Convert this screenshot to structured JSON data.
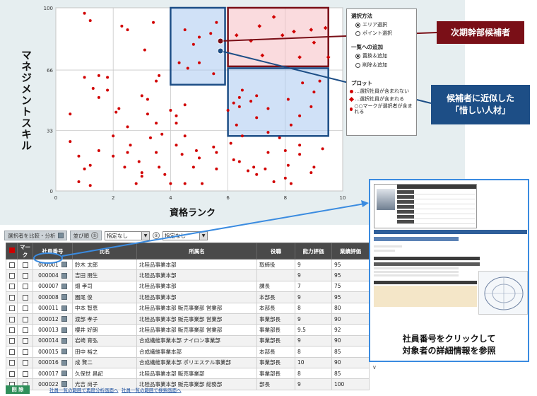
{
  "chart": {
    "y_axis_label": "マネジメントスキル",
    "x_axis_label": "資格ランク",
    "x_ticks": [
      "0",
      "2",
      "4",
      "6",
      "8",
      "10"
    ],
    "y_ticks": [
      "0",
      "33",
      "66",
      "100"
    ],
    "point_color": "#d10000",
    "highlight_red": "#7a0f17",
    "highlight_blue": "#1d4e86"
  },
  "chart_data": {
    "type": "scatter",
    "xlabel": "資格ランク",
    "ylabel": "マネジメントスキル",
    "xlim": [
      0,
      10
    ],
    "ylim": [
      0,
      100
    ],
    "grid": true,
    "series": [
      {
        "marker": "circle",
        "points": [
          [
            0.5,
            42
          ],
          [
            0.5,
            27
          ],
          [
            0.8,
            19
          ],
          [
            1.0,
            12
          ],
          [
            1.2,
            14
          ],
          [
            1.2,
            3
          ],
          [
            0.8,
            5
          ],
          [
            1.5,
            51
          ],
          [
            1.3,
            56
          ],
          [
            1.8,
            62
          ],
          [
            1.5,
            63
          ],
          [
            1.0,
            62
          ],
          [
            1.8,
            55
          ],
          [
            2.2,
            45
          ],
          [
            2.1,
            43
          ],
          [
            2.5,
            35
          ],
          [
            2.6,
            25
          ],
          [
            2.5,
            21
          ],
          [
            2.9,
            16
          ],
          [
            3.0,
            10
          ],
          [
            2.8,
            4
          ],
          [
            2.0,
            30
          ],
          [
            2.0,
            19
          ],
          [
            2.4,
            13
          ],
          [
            1.5,
            22
          ],
          [
            3.0,
            52
          ],
          [
            3.2,
            50
          ],
          [
            3.5,
            60
          ],
          [
            3.6,
            63
          ],
          [
            3.2,
            42
          ],
          [
            3.5,
            37
          ],
          [
            3.3,
            29
          ],
          [
            3.7,
            31
          ],
          [
            3.5,
            21
          ],
          [
            3.6,
            13
          ],
          [
            3.8,
            9
          ],
          [
            3.0,
            8
          ],
          [
            4.0,
            4
          ],
          [
            3.1,
            77
          ],
          [
            3.4,
            92
          ],
          [
            1.2,
            93
          ],
          [
            1.0,
            97
          ],
          [
            2.5,
            88
          ],
          [
            2.3,
            90
          ],
          [
            4.5,
            4
          ],
          [
            4.8,
            13
          ],
          [
            5.0,
            18
          ],
          [
            4.4,
            20
          ],
          [
            4.2,
            25
          ],
          [
            4.2,
            41
          ],
          [
            4.5,
            47
          ],
          [
            4.0,
            44
          ],
          [
            4.2,
            37
          ],
          [
            4.5,
            30
          ],
          [
            4.9,
            22
          ],
          [
            5.5,
            24
          ],
          [
            5.6,
            21
          ],
          [
            5.6,
            12
          ],
          [
            5.1,
            4
          ],
          [
            4.3,
            70
          ],
          [
            4.6,
            67
          ],
          [
            5.0,
            70
          ],
          [
            5.5,
            64
          ],
          [
            4.8,
            80
          ],
          [
            5.0,
            84
          ],
          [
            5.4,
            86
          ],
          [
            4.5,
            88
          ],
          [
            5.6,
            92
          ],
          [
            6.0,
            44
          ],
          [
            6.2,
            48
          ],
          [
            6.4,
            46
          ],
          [
            6.4,
            51
          ],
          [
            6.8,
            49
          ],
          [
            6.5,
            55
          ],
          [
            7.0,
            52
          ],
          [
            6.3,
            36
          ],
          [
            6.1,
            26
          ],
          [
            7.0,
            40
          ],
          [
            7.4,
            45
          ],
          [
            6.5,
            30
          ],
          [
            7.4,
            32
          ],
          [
            7.8,
            29
          ],
          [
            8.2,
            36
          ],
          [
            8.1,
            50
          ],
          [
            8.5,
            41
          ],
          [
            8.9,
            46
          ],
          [
            9.0,
            54
          ],
          [
            8.6,
            59
          ],
          [
            9.2,
            60
          ],
          [
            6.9,
            13
          ],
          [
            6.4,
            16
          ],
          [
            6.2,
            17
          ],
          [
            6.7,
            11
          ],
          [
            7.0,
            9
          ],
          [
            7.3,
            12
          ],
          [
            7.6,
            5
          ],
          [
            8.0,
            7
          ],
          [
            8.2,
            4
          ],
          [
            8.9,
            10
          ],
          [
            8.1,
            14
          ],
          [
            8.5,
            20
          ],
          [
            8.0,
            22
          ],
          [
            8.5,
            25
          ],
          [
            7.4,
            21
          ],
          [
            9.0,
            13
          ],
          [
            9.3,
            23
          ]
        ]
      },
      {
        "marker": "diamond",
        "points": [
          [
            6.3,
            85
          ],
          [
            6.8,
            82
          ],
          [
            7.1,
            90
          ],
          [
            7.6,
            95
          ],
          [
            7.9,
            85
          ],
          [
            8.3,
            87
          ],
          [
            8.9,
            88
          ],
          [
            9.4,
            89
          ],
          [
            7.2,
            74
          ],
          [
            8.5,
            73
          ],
          [
            9.0,
            81
          ],
          [
            9.5,
            73
          ]
        ]
      }
    ]
  },
  "controls": {
    "section1_title": "選択方法",
    "option_area": "エリア選択",
    "option_point": "ポイント選択",
    "section2_title": "一覧への追加",
    "option_replace": "置換＆追加",
    "option_delete": "削除＆追加",
    "section3_title": "プロット",
    "legend_dot": "…選択社員が含まれない",
    "legend_diamond": "…選択社員が含まれる",
    "legend_both": "○○マークが選択者が含まれる"
  },
  "callouts": {
    "top": "次期幹部候補者",
    "bottom_line1": "候補者に近似した",
    "bottom_line2": "「惜しい人材」"
  },
  "toolbar": {
    "compare_button": "選択者を比較・分析",
    "sort_button": "並び順",
    "select1_value": "指定なし",
    "select2_value": "指定なし"
  },
  "table": {
    "headers": [
      "",
      "マーク",
      "社員番号",
      "氏名",
      "所属名",
      "役職",
      "能力評価",
      "業績評価"
    ],
    "rows": [
      {
        "id": "000001",
        "name": "鈴木 太郎",
        "dept": "北陸品事業本部",
        "title": "取締役",
        "ability": "9",
        "perf": "95"
      },
      {
        "id": "000004",
        "name": "吉田 朋生",
        "dept": "北陸品事業本部",
        "title": "",
        "ability": "9",
        "perf": "95"
      },
      {
        "id": "000007",
        "name": "畑 孝司",
        "dept": "北陸品事業本部",
        "title": "課長",
        "ability": "7",
        "perf": "75"
      },
      {
        "id": "000008",
        "name": "園尾 俊",
        "dept": "北陸品事業本部",
        "title": "本部長",
        "ability": "9",
        "perf": "95"
      },
      {
        "id": "000011",
        "name": "中本 智恵",
        "dept": "北陸品事業本部 販売事業部 営業部",
        "title": "本部長",
        "ability": "8",
        "perf": "80"
      },
      {
        "id": "000012",
        "name": "渡部 孝子",
        "dept": "北陸品事業本部 販売事業部 営業部",
        "title": "事業部長",
        "ability": "9",
        "perf": "90"
      },
      {
        "id": "000013",
        "name": "櫻井 好朗",
        "dept": "北陸品事業本部 販売事業部 営業部",
        "title": "事業部長",
        "ability": "9.5",
        "perf": "92"
      },
      {
        "id": "000014",
        "name": "岩崎 育弘",
        "dept": "合成繊維事業本部 ナイロン事業部",
        "title": "事業部長",
        "ability": "9",
        "perf": "90"
      },
      {
        "id": "000015",
        "name": "田中 裕之",
        "dept": "合成繊維事業本部",
        "title": "本部長",
        "ability": "8",
        "perf": "85"
      },
      {
        "id": "000016",
        "name": "成 賢二",
        "dept": "合成繊維事業本部 ポリエステル事業部",
        "title": "事業部長",
        "ability": "10",
        "perf": "90"
      },
      {
        "id": "000017",
        "name": "久保世 昌記",
        "dept": "北陸品事業本部 販売事業部",
        "title": "事業部長",
        "ability": "8",
        "perf": "85"
      },
      {
        "id": "000022",
        "name": "光吉 尚子",
        "dept": "北陸品事業本部 販売事業部 総務部",
        "title": "部長",
        "ability": "9",
        "perf": "100"
      }
    ]
  },
  "bottom": {
    "delete_button": "削 除",
    "link1": "社員一覧の範囲で再度分析画面へ",
    "link2": "社員一覧の範囲で検索画面へ"
  },
  "preview": {
    "caption_line1": "社員番号をクリックして",
    "caption_line2": "対象者の詳細情報を参照"
  }
}
